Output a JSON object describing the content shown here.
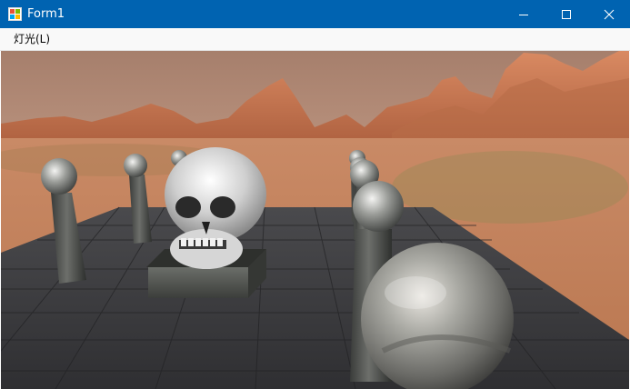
{
  "window": {
    "title": "Form1",
    "icon": "windows-form-icon",
    "titlebar_color": "#0063b1",
    "controls": {
      "minimize_icon": "minimize-icon",
      "maximize_icon": "maximize-icon",
      "close_icon": "close-icon"
    }
  },
  "menu": {
    "items": [
      {
        "label": "灯光(L)"
      }
    ]
  },
  "scene": {
    "description_icon": "3d-viewport",
    "sky_color": "#c89a84",
    "terrain_color": "#c9825e",
    "floor_color": "#3d3d40",
    "objects": [
      "skull-on-pedestal",
      "chrome-spheres-on-pillars",
      "large-mirror-sphere"
    ]
  }
}
